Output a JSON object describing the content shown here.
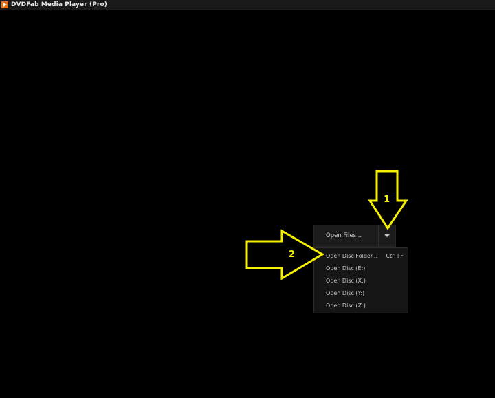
{
  "window": {
    "title": "DVDFab Media Player (Pro)"
  },
  "open_files": {
    "label": "Open Files...",
    "dropdown_icon": "chevron-down-icon"
  },
  "menu": {
    "items": [
      {
        "label": "Open Disc Folder...",
        "shortcut": "Ctrl+F"
      },
      {
        "label": "Open Disc (E:)",
        "shortcut": ""
      },
      {
        "label": "Open Disc (X:)",
        "shortcut": ""
      },
      {
        "label": "Open Disc (Y:)",
        "shortcut": ""
      },
      {
        "label": "Open Disc (Z:)",
        "shortcut": ""
      }
    ]
  },
  "annotations": {
    "arrow1_label": "1",
    "arrow2_label": "2",
    "color": "#f5f000",
    "fill": "#000000"
  },
  "colors": {
    "background": "#000000",
    "app_icon": "#e0701c"
  }
}
